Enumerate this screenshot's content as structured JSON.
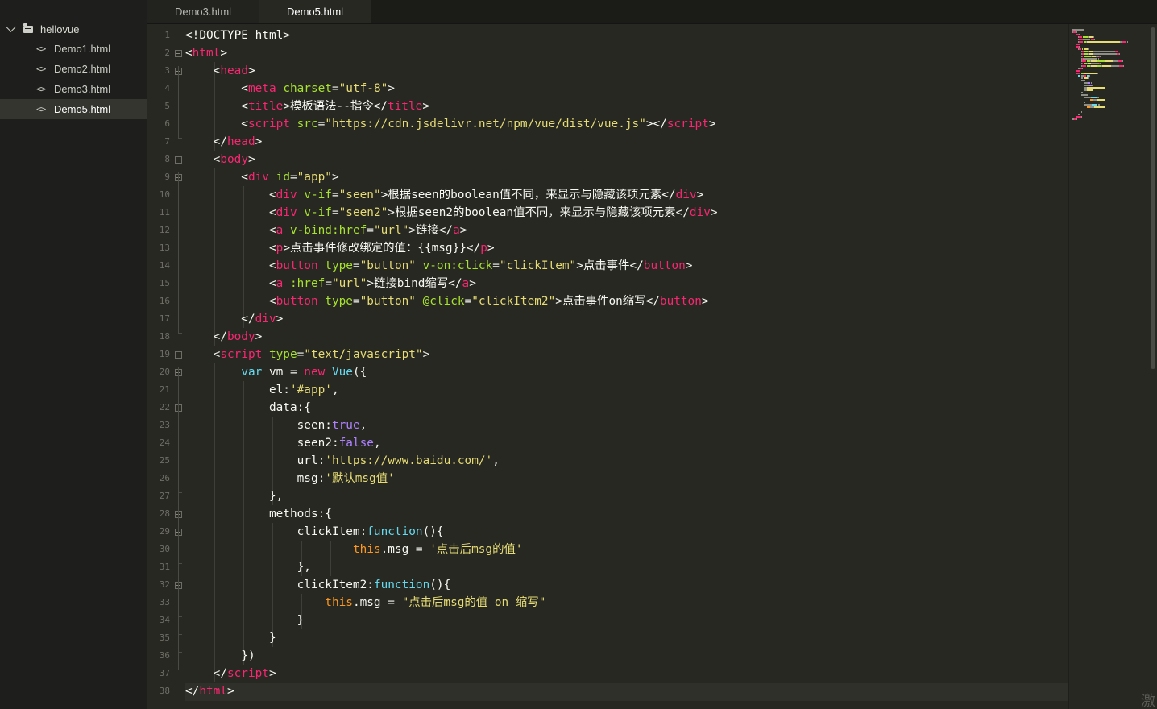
{
  "sidebar": {
    "folder": "hellovue",
    "files": [
      {
        "icon": "<>",
        "label": "Demo1.html"
      },
      {
        "icon": "<>",
        "label": "Demo2.html"
      },
      {
        "icon": "<>",
        "label": "Demo3.html"
      },
      {
        "icon": "<>",
        "label": "Demo5.html",
        "active": true
      }
    ]
  },
  "tabs": [
    {
      "label": "Demo3.html"
    },
    {
      "label": "Demo5.html",
      "active": true
    }
  ],
  "line_numbers": [
    "1",
    "2",
    "3",
    "4",
    "5",
    "6",
    "7",
    "8",
    "9",
    "10",
    "11",
    "12",
    "13",
    "14",
    "15",
    "16",
    "17",
    "18",
    "19",
    "20",
    "21",
    "22",
    "23",
    "24",
    "25",
    "26",
    "27",
    "28",
    "29",
    "30",
    "31",
    "32",
    "33",
    "34",
    "35",
    "36",
    "37",
    "38"
  ],
  "code_lines": [
    [
      [
        "<!DOCTYPE html>",
        ""
      ]
    ],
    [
      [
        "<",
        ""
      ],
      [
        "html",
        "t"
      ],
      [
        ">",
        ""
      ]
    ],
    [
      [
        "    <",
        ""
      ],
      [
        "head",
        "t"
      ],
      [
        ">",
        ""
      ]
    ],
    [
      [
        "        <",
        ""
      ],
      [
        "meta",
        "t"
      ],
      [
        " ",
        ""
      ],
      [
        "charset",
        "a"
      ],
      [
        "=",
        ""
      ],
      [
        "\"utf-8\"",
        "s"
      ],
      [
        ">",
        ""
      ]
    ],
    [
      [
        "        <",
        ""
      ],
      [
        "title",
        "t"
      ],
      [
        ">模板语法--指令</",
        ""
      ],
      [
        "title",
        "t"
      ],
      [
        ">",
        ""
      ]
    ],
    [
      [
        "        <",
        ""
      ],
      [
        "script",
        "t"
      ],
      [
        " ",
        ""
      ],
      [
        "src",
        "a"
      ],
      [
        "=",
        ""
      ],
      [
        "\"https://cdn.jsdelivr.net/npm/vue/dist/vue.js\"",
        "s"
      ],
      [
        "></",
        ""
      ],
      [
        "script",
        "t"
      ],
      [
        ">",
        ""
      ]
    ],
    [
      [
        "    </",
        ""
      ],
      [
        "head",
        "t"
      ],
      [
        ">",
        ""
      ]
    ],
    [
      [
        "    <",
        ""
      ],
      [
        "body",
        "t"
      ],
      [
        ">",
        ""
      ]
    ],
    [
      [
        "        <",
        ""
      ],
      [
        "div",
        "t"
      ],
      [
        " ",
        ""
      ],
      [
        "id",
        "a"
      ],
      [
        "=",
        ""
      ],
      [
        "\"app\"",
        "s"
      ],
      [
        ">",
        ""
      ]
    ],
    [
      [
        "            <",
        ""
      ],
      [
        "div",
        "t"
      ],
      [
        " ",
        ""
      ],
      [
        "v-if",
        "a"
      ],
      [
        "=",
        ""
      ],
      [
        "\"seen\"",
        "s"
      ],
      [
        ">根据seen的boolean值不同，来显示与隐藏该项元素</",
        ""
      ],
      [
        "div",
        "t"
      ],
      [
        ">",
        ""
      ]
    ],
    [
      [
        "            <",
        ""
      ],
      [
        "div",
        "t"
      ],
      [
        " ",
        ""
      ],
      [
        "v-if",
        "a"
      ],
      [
        "=",
        ""
      ],
      [
        "\"seen2\"",
        "s"
      ],
      [
        ">根据seen2的boolean值不同，来显示与隐藏该项元素</",
        ""
      ],
      [
        "div",
        "t"
      ],
      [
        ">",
        ""
      ]
    ],
    [
      [
        "            <",
        ""
      ],
      [
        "a",
        "t"
      ],
      [
        " ",
        ""
      ],
      [
        "v-bind:href",
        "a"
      ],
      [
        "=",
        ""
      ],
      [
        "\"url\"",
        "s"
      ],
      [
        ">链接</",
        ""
      ],
      [
        "a",
        "t"
      ],
      [
        ">",
        ""
      ]
    ],
    [
      [
        "            <",
        ""
      ],
      [
        "p",
        "t"
      ],
      [
        ">点击事件修改绑定的值：{{msg}}</",
        ""
      ],
      [
        "p",
        "t"
      ],
      [
        ">",
        ""
      ]
    ],
    [
      [
        "            <",
        ""
      ],
      [
        "button",
        "t"
      ],
      [
        " ",
        ""
      ],
      [
        "type",
        "a"
      ],
      [
        "=",
        ""
      ],
      [
        "\"button\"",
        "s"
      ],
      [
        " ",
        ""
      ],
      [
        "v-on:click",
        "a"
      ],
      [
        "=",
        ""
      ],
      [
        "\"clickItem\"",
        "s"
      ],
      [
        ">点击事件</",
        ""
      ],
      [
        "button",
        "t"
      ],
      [
        ">",
        ""
      ]
    ],
    [
      [
        "            <",
        ""
      ],
      [
        "a",
        "t"
      ],
      [
        " ",
        ""
      ],
      [
        ":href",
        "a"
      ],
      [
        "=",
        ""
      ],
      [
        "\"url\"",
        "s"
      ],
      [
        ">链接bind缩写</",
        ""
      ],
      [
        "a",
        "t"
      ],
      [
        ">",
        ""
      ]
    ],
    [
      [
        "            <",
        ""
      ],
      [
        "button",
        "t"
      ],
      [
        " ",
        ""
      ],
      [
        "type",
        "a"
      ],
      [
        "=",
        ""
      ],
      [
        "\"button\"",
        "s"
      ],
      [
        " ",
        ""
      ],
      [
        "@click",
        "a"
      ],
      [
        "=",
        ""
      ],
      [
        "\"clickItem2\"",
        "s"
      ],
      [
        ">点击事件on缩写</",
        ""
      ],
      [
        "button",
        "t"
      ],
      [
        ">",
        ""
      ]
    ],
    [
      [
        "        </",
        ""
      ],
      [
        "div",
        "t"
      ],
      [
        ">",
        ""
      ]
    ],
    [
      [
        "    </",
        ""
      ],
      [
        "body",
        "t"
      ],
      [
        ">",
        ""
      ]
    ],
    [
      [
        "    <",
        ""
      ],
      [
        "script",
        "t"
      ],
      [
        " ",
        ""
      ],
      [
        "type",
        "a"
      ],
      [
        "=",
        ""
      ],
      [
        "\"text/javascript\"",
        "s"
      ],
      [
        ">",
        ""
      ]
    ],
    [
      [
        "        ",
        ""
      ],
      [
        "var",
        "k"
      ],
      [
        " vm = ",
        ""
      ],
      [
        "new",
        "t"
      ],
      [
        " ",
        ""
      ],
      [
        "Vue",
        "k"
      ],
      [
        "({",
        ""
      ]
    ],
    [
      [
        "            el:",
        ""
      ],
      [
        "'#app'",
        "s"
      ],
      [
        ",",
        ""
      ]
    ],
    [
      [
        "            data:{",
        ""
      ]
    ],
    [
      [
        "                seen:",
        ""
      ],
      [
        "true",
        "b"
      ],
      [
        ",",
        ""
      ]
    ],
    [
      [
        "                seen2:",
        ""
      ],
      [
        "false",
        "b"
      ],
      [
        ",",
        ""
      ]
    ],
    [
      [
        "                url:",
        ""
      ],
      [
        "'https://www.baidu.com/'",
        "s"
      ],
      [
        ",",
        ""
      ]
    ],
    [
      [
        "                msg:",
        ""
      ],
      [
        "'默认msg值'",
        "s"
      ]
    ],
    [
      [
        "            },",
        ""
      ]
    ],
    [
      [
        "            methods:{",
        ""
      ]
    ],
    [
      [
        "                clickItem:",
        ""
      ],
      [
        "function",
        "k"
      ],
      [
        "(){",
        ""
      ]
    ],
    [
      [
        "                        ",
        ""
      ],
      [
        "this",
        "v"
      ],
      [
        ".msg = ",
        ""
      ],
      [
        "'点击后msg的值'",
        "s"
      ]
    ],
    [
      [
        "                },",
        ""
      ]
    ],
    [
      [
        "                clickItem2:",
        ""
      ],
      [
        "function",
        "k"
      ],
      [
        "(){",
        ""
      ]
    ],
    [
      [
        "                    ",
        ""
      ],
      [
        "this",
        "v"
      ],
      [
        ".msg = ",
        ""
      ],
      [
        "\"点击后msg的值 on 缩写\"",
        "s"
      ]
    ],
    [
      [
        "                }",
        ""
      ]
    ],
    [
      [
        "            }",
        ""
      ]
    ],
    [
      [
        "        })",
        ""
      ]
    ],
    [
      [
        "    </",
        ""
      ],
      [
        "script",
        "t"
      ],
      [
        ">",
        ""
      ]
    ],
    [
      [
        "</",
        ""
      ],
      [
        "html",
        "t"
      ],
      [
        ">",
        ""
      ]
    ]
  ],
  "colors": {
    "background": "#272822",
    "sidebar": "#1e1f1c",
    "tag": "#f92672",
    "attr": "#a6e22e",
    "string": "#e6db74",
    "keyword": "#66d9ef",
    "this": "#fd971f",
    "boolean": "#ae81ff"
  },
  "watermark": "激"
}
